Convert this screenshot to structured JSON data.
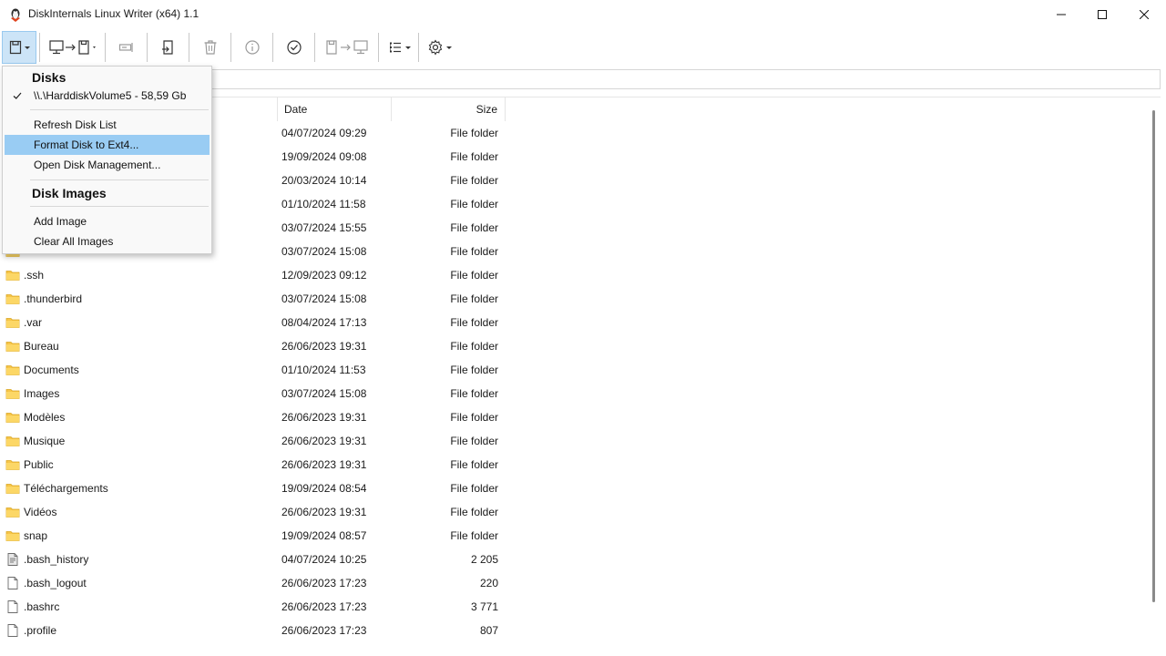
{
  "window": {
    "title": "DiskInternals Linux Writer (x64) 1.1",
    "accent_color": "#99ccf3"
  },
  "toolbar": {
    "buttons": [
      {
        "name": "disk-selector-button",
        "icon": "disk-icon"
      },
      {
        "name": "write-to-disk-button",
        "icon": "computer-to-disk-icon"
      },
      {
        "name": "rename-button",
        "icon": "rename-icon"
      },
      {
        "name": "export-button",
        "icon": "export-icon"
      },
      {
        "name": "delete-button",
        "icon": "trash-icon"
      },
      {
        "name": "properties-button",
        "icon": "info-icon"
      },
      {
        "name": "check-button",
        "icon": "check-circle-icon"
      },
      {
        "name": "disk-to-computer-button",
        "icon": "disk-to-computer-icon"
      },
      {
        "name": "view-button",
        "icon": "list-view-icon"
      },
      {
        "name": "settings-button",
        "icon": "gear-icon"
      }
    ]
  },
  "menu": {
    "disks_header": "Disks",
    "selected_disk": "\\\\.\\HarddiskVolume5 - 58,59 Gb",
    "refresh": "Refresh Disk List",
    "format": "Format Disk to Ext4...",
    "open_mgmt": "Open Disk Management...",
    "images_header": "Disk Images",
    "add_image": "Add Image",
    "clear_images": "Clear All Images"
  },
  "filelist": {
    "columns": {
      "date": "Date",
      "size": "Size"
    },
    "rows": [
      {
        "name": "",
        "date": "04/07/2024 09:29",
        "size": "File folder",
        "type": "folder"
      },
      {
        "name": "",
        "date": "19/09/2024 09:08",
        "size": "File folder",
        "type": "folder"
      },
      {
        "name": "",
        "date": "20/03/2024 10:14",
        "size": "File folder",
        "type": "folder"
      },
      {
        "name": "",
        "date": "01/10/2024 11:58",
        "size": "File folder",
        "type": "folder"
      },
      {
        "name": "",
        "date": "03/07/2024 15:55",
        "size": "File folder",
        "type": "folder"
      },
      {
        "name": "",
        "date": "03/07/2024 15:08",
        "size": "File folder",
        "type": "folder"
      },
      {
        "name": ".ssh",
        "date": "12/09/2023 09:12",
        "size": "File folder",
        "type": "folder"
      },
      {
        "name": ".thunderbird",
        "date": "03/07/2024 15:08",
        "size": "File folder",
        "type": "folder"
      },
      {
        "name": ".var",
        "date": "08/04/2024 17:13",
        "size": "File folder",
        "type": "folder"
      },
      {
        "name": "Bureau",
        "date": "26/06/2023 19:31",
        "size": "File folder",
        "type": "folder"
      },
      {
        "name": "Documents",
        "date": "01/10/2024 11:53",
        "size": "File folder",
        "type": "folder"
      },
      {
        "name": "Images",
        "date": "03/07/2024 15:08",
        "size": "File folder",
        "type": "folder"
      },
      {
        "name": "Modèles",
        "date": "26/06/2023 19:31",
        "size": "File folder",
        "type": "folder"
      },
      {
        "name": "Musique",
        "date": "26/06/2023 19:31",
        "size": "File folder",
        "type": "folder"
      },
      {
        "name": "Public",
        "date": "26/06/2023 19:31",
        "size": "File folder",
        "type": "folder"
      },
      {
        "name": "Téléchargements",
        "date": "19/09/2024 08:54",
        "size": "File folder",
        "type": "folder"
      },
      {
        "name": "Vidéos",
        "date": "26/06/2023 19:31",
        "size": "File folder",
        "type": "folder"
      },
      {
        "name": "snap",
        "date": "19/09/2024 08:57",
        "size": "File folder",
        "type": "folder"
      },
      {
        "name": ".bash_history",
        "date": "04/07/2024 10:25",
        "size": "2 205",
        "type": "textfile"
      },
      {
        "name": ".bash_logout",
        "date": "26/06/2023 17:23",
        "size": "220",
        "type": "file"
      },
      {
        "name": ".bashrc",
        "date": "26/06/2023 17:23",
        "size": "3 771",
        "type": "file"
      },
      {
        "name": ".profile",
        "date": "26/06/2023 17:23",
        "size": "807",
        "type": "file"
      }
    ]
  }
}
